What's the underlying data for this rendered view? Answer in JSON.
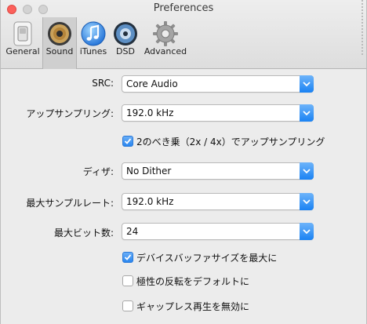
{
  "window": {
    "title": "Preferences"
  },
  "toolbar": {
    "tabs": [
      {
        "label": "General",
        "icon": "switch-icon"
      },
      {
        "label": "Sound",
        "icon": "speaker-icon"
      },
      {
        "label": "iTunes",
        "icon": "itunes-icon"
      },
      {
        "label": "DSD",
        "icon": "dsd-disc-icon"
      },
      {
        "label": "Advanced",
        "icon": "gear-icon"
      }
    ],
    "selected_tab": "Sound"
  },
  "settings": {
    "src": {
      "label": "SRC:",
      "value": "Core Audio"
    },
    "upsampling": {
      "label": "アップサンプリング:",
      "value": "192.0 kHz"
    },
    "power_of_two": {
      "label": "2のべき乗（2x / 4x）でアップサンプリング",
      "checked": true
    },
    "dither": {
      "label": "ディザ:",
      "value": "No Dither"
    },
    "max_sample_rate": {
      "label": "最大サンプルレート:",
      "value": "192.0 kHz"
    },
    "max_bits": {
      "label": "最大ビット数:",
      "value": "24"
    },
    "max_device_buffer": {
      "label": "デバイスバッファサイズを最大に",
      "checked": true
    },
    "invert_polarity": {
      "label": "極性の反転をデフォルトに",
      "checked": false
    },
    "disable_gapless": {
      "label": "ギャップレス再生を無効に",
      "checked": false
    }
  },
  "colors": {
    "accent": "#1a82f3",
    "close_button": "#fc605b",
    "window_bg": "#ececec"
  }
}
